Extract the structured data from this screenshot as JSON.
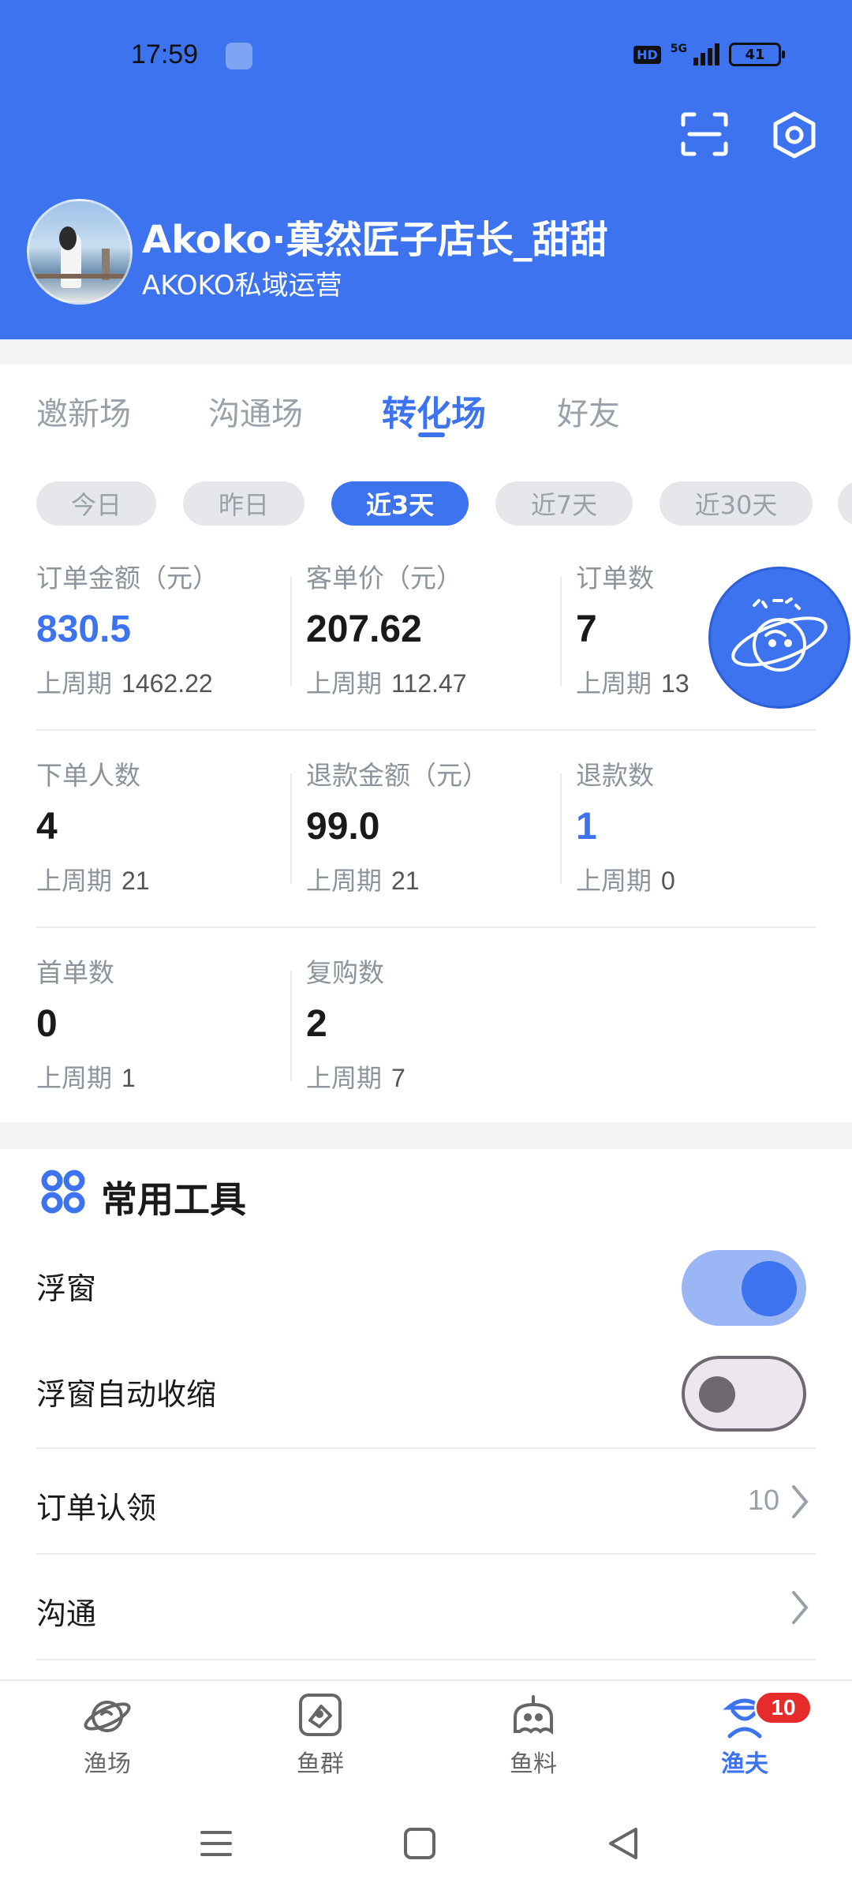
{
  "status_bar": {
    "time": "17:59",
    "hd": "HD",
    "network": "5G",
    "battery": "41"
  },
  "header": {
    "user_name": "Akoko·菓然匠子店长_甜甜",
    "user_role": "AKOKO私域运营",
    "icons": [
      "scan-icon",
      "settings-icon"
    ]
  },
  "tabs": [
    "邀新场",
    "沟通场",
    "转化场",
    "好友"
  ],
  "active_tab": "转化场",
  "ranges": [
    "今日",
    "昨日",
    "近3天",
    "近7天",
    "近30天"
  ],
  "active_range": "近3天",
  "prev_label": "上周期",
  "metrics": [
    {
      "label": "订单金额（元）",
      "value": "830.5",
      "prev": "1462.22"
    },
    {
      "label": "客单价（元）",
      "value": "207.62",
      "prev": "112.47"
    },
    {
      "label": "订单数",
      "value": "7",
      "prev": "13"
    },
    {
      "label": "下单人数",
      "value": "4",
      "prev": "21"
    },
    {
      "label": "退款金额（元）",
      "value": "99.0",
      "prev": "21"
    },
    {
      "label": "退款数",
      "value": "1",
      "prev": "0"
    },
    {
      "label": "首单数",
      "value": "0",
      "prev": "1"
    },
    {
      "label": "复购数",
      "value": "2",
      "prev": "7"
    }
  ],
  "tools": {
    "title": "常用工具",
    "float_window": {
      "label": "浮窗",
      "enabled": true
    },
    "auto_shrink": {
      "label": "浮窗自动收缩",
      "enabled": false
    },
    "order_claim": {
      "label": "订单认领",
      "count": "10"
    },
    "chat": {
      "label": "沟通"
    }
  },
  "bottom_nav": [
    {
      "label": "渔场",
      "icon": "planet-icon"
    },
    {
      "label": "鱼群",
      "icon": "fish-group-icon"
    },
    {
      "label": "鱼料",
      "icon": "bait-icon"
    },
    {
      "label": "渔夫",
      "icon": "fisherman-icon",
      "badge": "10"
    }
  ],
  "active_nav": "渔夫",
  "colors": {
    "accent": "#3d73ee",
    "badge": "#e62b2b"
  }
}
